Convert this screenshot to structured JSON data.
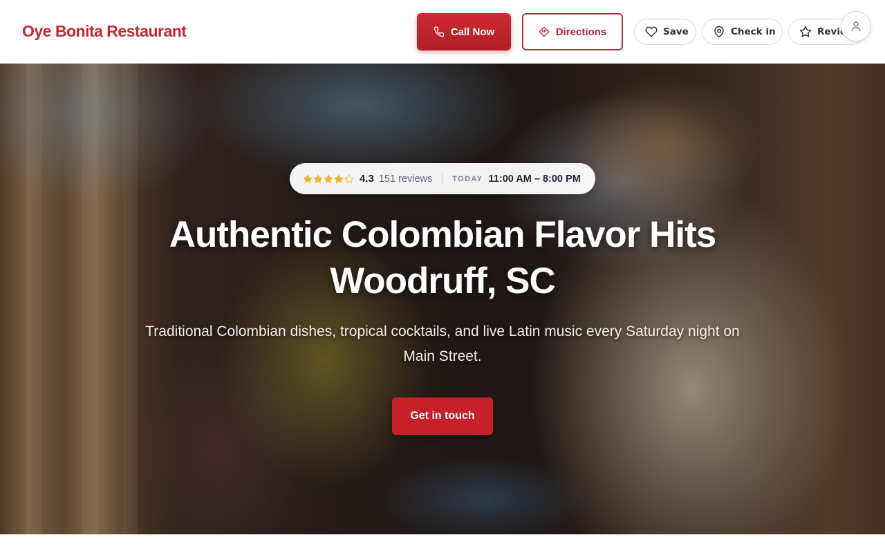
{
  "header": {
    "brand": "Oye Bonita Restaurant",
    "call_label": "Call Now",
    "directions_label": "Directions",
    "save_label": "Save",
    "checkin_label": "Check in",
    "review_label": "Review"
  },
  "hero": {
    "rating": "4.3",
    "reviews": "151 reviews",
    "stars_filled": 4.3,
    "today_label": "TODAY",
    "hours": "11:00 AM – 8:00 PM",
    "headline": "Authentic Colombian Flavor Hits Woodruff, SC",
    "subtext": "Traditional Colombian dishes, tropical cocktails, and live Latin music every Saturday night on Main Street.",
    "cta_label": "Get in touch"
  },
  "colors": {
    "brand_red": "#c62833",
    "star_gold": "#f0b429"
  },
  "icons": [
    "phone-icon",
    "directions-icon",
    "heart-icon",
    "pin-icon",
    "star-icon",
    "user-icon"
  ]
}
